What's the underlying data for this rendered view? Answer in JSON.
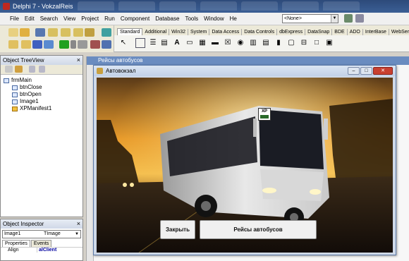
{
  "ide": {
    "title": "Delphi 7 - VokzalReis",
    "menu": [
      "File",
      "Edit",
      "Search",
      "View",
      "Project",
      "Run",
      "Component",
      "Database",
      "Tools",
      "Window",
      "Help"
    ],
    "config_combo": "<None>",
    "palette_tabs": [
      "Standard",
      "Additional",
      "Win32",
      "System",
      "Data Access",
      "Data Controls",
      "dbExpress",
      "DataSnap",
      "BDE",
      "ADO",
      "InterBase",
      "WebSer"
    ]
  },
  "tree_view": {
    "title": "Object TreeView",
    "root": "frmMain",
    "children": [
      "btnClose",
      "btnOpen",
      "Image1",
      "XPManifest1"
    ]
  },
  "inspector": {
    "title": "Object Inspector",
    "selected_name": "Image1",
    "selected_type": "TImage",
    "tabs": [
      "Properties",
      "Events"
    ],
    "rows": [
      {
        "key": "Align",
        "value": "alClient"
      }
    ]
  },
  "designer": {
    "title": "Рейсы автобусов"
  },
  "form": {
    "title": "Автовокзал",
    "close_button": "Закрыть",
    "routes_button": "Рейсы автобусов",
    "xp_badge": "XP"
  }
}
